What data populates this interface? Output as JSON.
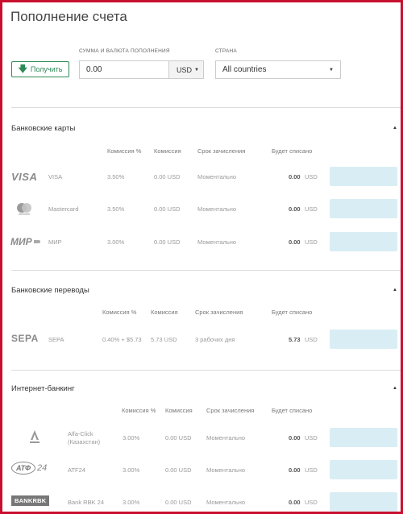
{
  "page": {
    "title": "Пополнение счета"
  },
  "toolbar": {
    "receive_label": "Получить",
    "amount_label": "СУММА И ВАЛЮТА ПОПОЛНЕНИЯ",
    "amount_value": "0.00",
    "currency": "USD",
    "country_label": "СТРАНА",
    "country_value": "All countries"
  },
  "columns": {
    "commission_pct": "Комиссия %",
    "commission": "Комиссия",
    "term": "Срок зачисления",
    "debited": "Будет списано"
  },
  "sections": [
    {
      "title": "Банковские карты",
      "rows": [
        {
          "logo": "visa-logo",
          "name": "VISA",
          "pct": "3.50%",
          "fee": "0.00 USD",
          "term": "Моментально",
          "amount": "0.00",
          "currency": "USD"
        },
        {
          "logo": "mastercard-logo",
          "name": "Mastercard",
          "pct": "3.50%",
          "fee": "0.00 USD",
          "term": "Моментально",
          "amount": "0.00",
          "currency": "USD"
        },
        {
          "logo": "mir-logo",
          "name": "МИР",
          "pct": "3.00%",
          "fee": "0.00 USD",
          "term": "Моментально",
          "amount": "0.00",
          "currency": "USD"
        }
      ]
    },
    {
      "title": "Банковские переводы",
      "rows": [
        {
          "logo": "sepa-logo",
          "name": "SEPA",
          "pct": "0.40% + $5.73",
          "fee": "5.73 USD",
          "term": "3 рабочих дня",
          "amount": "5.73",
          "currency": "USD"
        }
      ]
    },
    {
      "title": "Интернет-банкинг",
      "rows": [
        {
          "logo": "alfa-logo",
          "name": "Alfa-Click (Казахстан)",
          "name_line1": "Alfa-Click",
          "name_line2": "(Казахстан)",
          "pct": "3.00%",
          "fee": "0.00 USD",
          "term": "Моментально",
          "amount": "0.00",
          "currency": "USD"
        },
        {
          "logo": "atf-logo",
          "name": "ATF24",
          "pct": "3.00%",
          "fee": "0.00 USD",
          "term": "Моментально",
          "amount": "0.00",
          "currency": "USD"
        },
        {
          "logo": "bankrbk-logo",
          "name": "Bank RBK 24",
          "pct": "3.00%",
          "fee": "0.00 USD",
          "term": "Моментально",
          "amount": "0.00",
          "currency": "USD"
        }
      ]
    }
  ],
  "logos": {
    "visa": "VISA",
    "mir": "МИР",
    "sepa": "SEPA",
    "atf_a": "АТФ",
    "atf_b": "24",
    "bankrbk": "BANKRBK"
  },
  "colors": {
    "accent_green": "#2e8b57",
    "frame_red": "#c8102e",
    "action_button": "#d9eef4"
  }
}
